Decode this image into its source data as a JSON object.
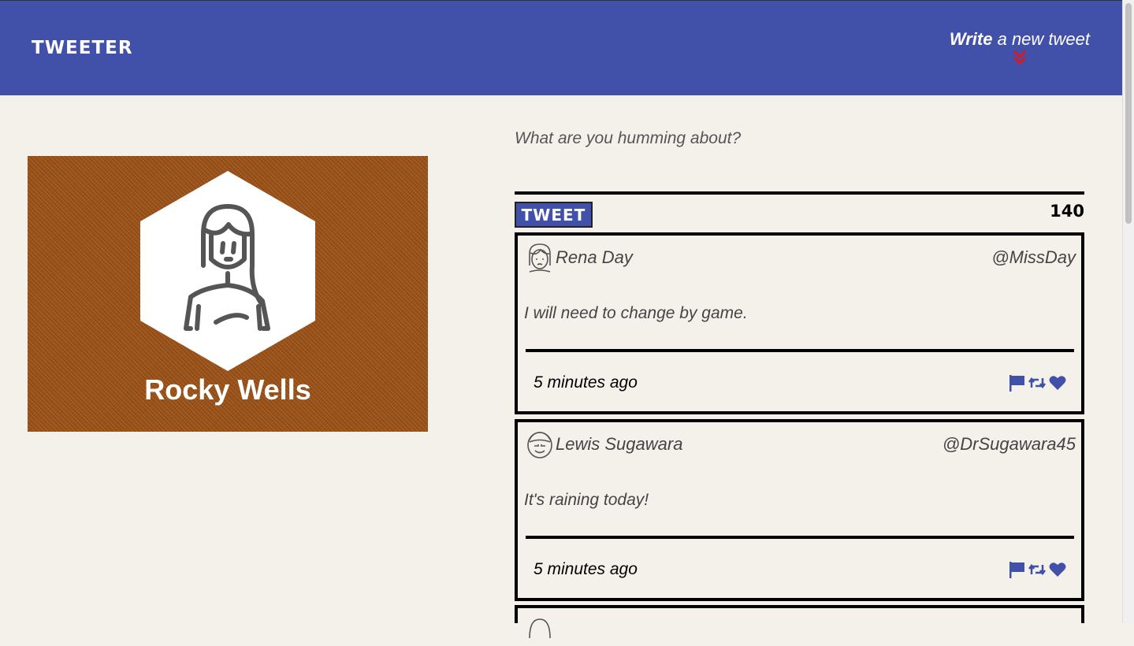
{
  "nav": {
    "brand": "TWEETER",
    "write_bold": "Write",
    "write_rest": " a new tweet"
  },
  "colors": {
    "primary": "#4150a8",
    "background": "#f4f1ea",
    "profile_bg": "#a05418",
    "chevron": "#e0161d"
  },
  "profile": {
    "name": "Rocky Wells",
    "avatar_icon": "woman-avatar-icon"
  },
  "composer": {
    "placeholder": "What are you humming about?",
    "button_label": "TWEET",
    "counter": "140"
  },
  "tweets": [
    {
      "name": "Rena Day",
      "handle": "@MissDay",
      "content": "I will need to change by game.",
      "time": "5 minutes ago",
      "avatar_icon": "woman-avatar-icon"
    },
    {
      "name": "Lewis Sugawara",
      "handle": "@DrSugawara45",
      "content": "It's raining today!",
      "time": "5 minutes ago",
      "avatar_icon": "man-avatar-icon"
    }
  ]
}
